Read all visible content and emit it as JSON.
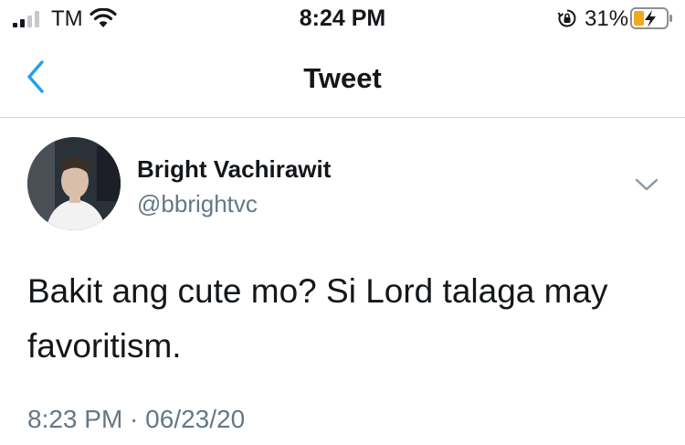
{
  "status_bar": {
    "carrier": "TM",
    "time": "8:24 PM",
    "battery_percent": "31%",
    "icons": [
      "signal-icon",
      "wifi-icon",
      "orientation-lock-icon",
      "battery-charging-icon"
    ]
  },
  "nav": {
    "title": "Tweet",
    "back_icon": "chevron-left-icon"
  },
  "tweet": {
    "author_name": "Bright Vachirawit",
    "author_handle": "@bbrightvc",
    "text": "Bakit ang cute mo? Si Lord talaga may favoritism.",
    "time": "8:23 PM",
    "separator": " · ",
    "date": "06/23/20",
    "menu_icon": "chevron-down-icon"
  },
  "colors": {
    "accent": "#1da1f2",
    "secondary_text": "#657786",
    "primary_text": "#14171a",
    "divider": "#cfd3d6"
  }
}
